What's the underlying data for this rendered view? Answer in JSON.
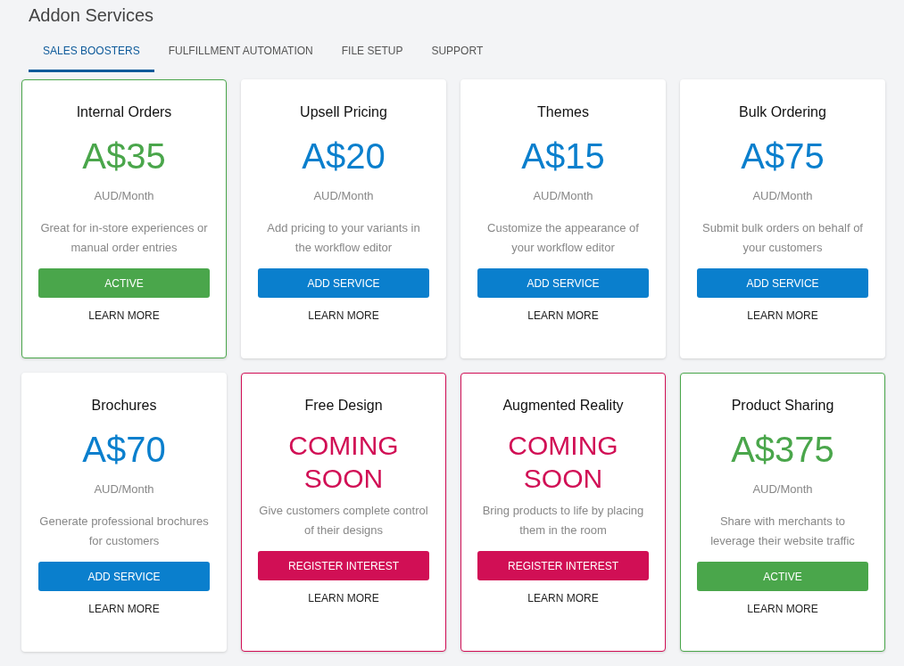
{
  "page": {
    "title": "Addon Services"
  },
  "tabs": [
    {
      "label": "SALES BOOSTERS",
      "selected": true
    },
    {
      "label": "FULFILLMENT AUTOMATION",
      "selected": false
    },
    {
      "label": "FILE SETUP",
      "selected": false
    },
    {
      "label": "SUPPORT",
      "selected": false
    }
  ],
  "services": [
    {
      "kind": "active",
      "name": "Internal Orders",
      "price": "A$35",
      "period": "AUD/Month",
      "description": "Great for in-store experiences or manual order entries",
      "action": "ACTIVE",
      "link": "LEARN MORE"
    },
    {
      "kind": "available",
      "name": "Upsell Pricing",
      "price": "A$20",
      "period": "AUD/Month",
      "description": "Add pricing to your variants in the workflow editor",
      "action": "ADD SERVICE",
      "link": "LEARN MORE"
    },
    {
      "kind": "available",
      "name": "Themes",
      "price": "A$15",
      "period": "AUD/Month",
      "description": "Customize the appearance of your workflow editor",
      "action": "ADD SERVICE",
      "link": "LEARN MORE"
    },
    {
      "kind": "available",
      "name": "Bulk Ordering",
      "price": "A$75",
      "period": "AUD/Month",
      "description": "Submit bulk orders on behalf of your customers",
      "action": "ADD SERVICE",
      "link": "LEARN MORE"
    },
    {
      "kind": "available",
      "name": "Brochures",
      "price": "A$70",
      "period": "AUD/Month",
      "description": "Generate professional brochures for customers",
      "action": "ADD SERVICE",
      "link": "LEARN MORE"
    },
    {
      "kind": "coming_soon",
      "name": "Free Design",
      "price": "COMING SOON",
      "description": "Give customers complete control of their designs",
      "action": "REGISTER INTEREST",
      "link": "LEARN MORE"
    },
    {
      "kind": "coming_soon",
      "name": "Augmented Reality",
      "price": "COMING SOON",
      "description": "Bring products to life by placing them in the room",
      "action": "REGISTER INTEREST",
      "link": "LEARN MORE"
    },
    {
      "kind": "active",
      "name": "Product Sharing",
      "price": "A$375",
      "period": "AUD/Month",
      "description": "Share with merchants to leverage their website traffic",
      "action": "ACTIVE",
      "link": "LEARN MORE"
    }
  ]
}
